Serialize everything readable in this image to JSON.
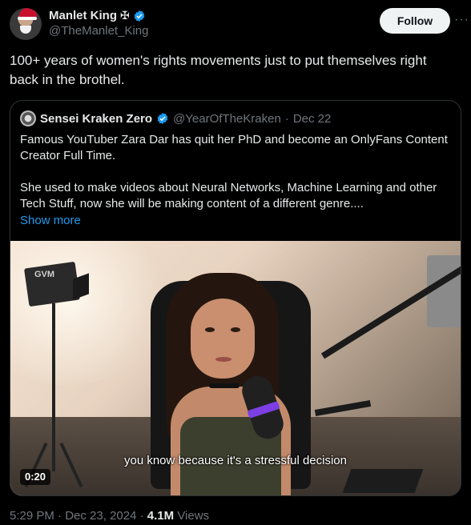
{
  "author": {
    "display_name": "Manlet King",
    "suffix_symbol": "✠",
    "handle": "@TheManlet_King"
  },
  "follow_label": "Follow",
  "more_symbol": "···",
  "tweet_text": "100+ years of women's rights movements just to put themselves right back in the brothel.",
  "quote": {
    "display_name": "Sensei Kraken Zero",
    "handle": "@YearOfTheKraken",
    "separator": "·",
    "date": "Dec 22",
    "paragraph1": "Famous YouTuber Zara Dar has quit her PhD and become an OnlyFans Content Creator Full Time.",
    "paragraph2": "She used to make videos about Neural Networks, Machine Learning and other Tech Stuff, now she will be making content of a different genre....",
    "show_more": "Show more",
    "media": {
      "caption": "you know because it's a stressful decision",
      "duration": "0:20",
      "light_label": "GVM"
    }
  },
  "meta": {
    "time": "5:29 PM",
    "separator": "·",
    "date": "Dec 23, 2024",
    "views_count": "4.1M",
    "views_label": "Views"
  },
  "colors": {
    "verified": "#1d9bf0",
    "link": "#1d9bf0",
    "secondary_text": "#71767b",
    "background": "#000000"
  },
  "icons": [
    "verified-badge-icon",
    "more-icon",
    "cross-icon"
  ]
}
